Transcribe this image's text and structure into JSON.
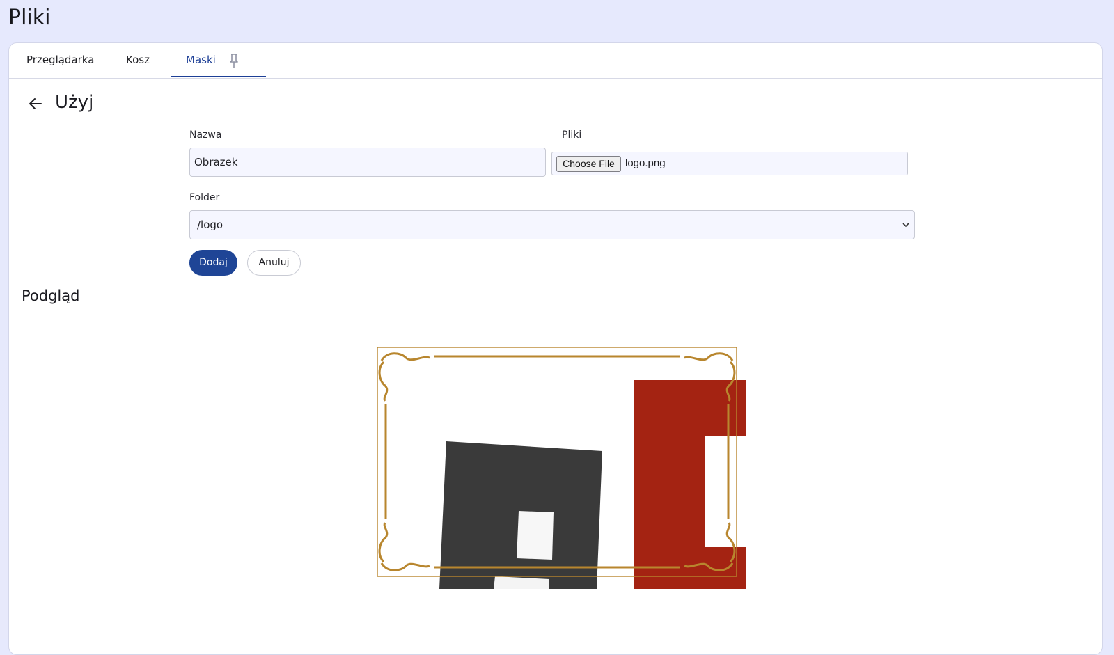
{
  "app": {
    "title": "Pliki"
  },
  "tabs": [
    {
      "label": "Przeglądarka",
      "active": false
    },
    {
      "label": "Kosz",
      "active": false
    },
    {
      "label": "Maski",
      "active": true
    }
  ],
  "page": {
    "title": "Użyj"
  },
  "form": {
    "name": {
      "label": "Nazwa",
      "value": "Obrazek"
    },
    "files": {
      "label": "Pliki",
      "button_label": "Choose File",
      "file_name": "logo.png"
    },
    "folder": {
      "label": "Folder",
      "selected": "/logo"
    },
    "add_label": "Dodaj",
    "cancel_label": "Anuluj"
  },
  "preview": {
    "title": "Podgląd"
  },
  "colors": {
    "accent": "#1f4596",
    "frame_gold": "#b8862e",
    "logo_dark": "#3a3a3a",
    "logo_red": "#a42312",
    "background": "#e6e9fd"
  },
  "icons": {
    "back": "arrow-left-icon",
    "pin": "pin-icon",
    "select_chevron": "chevron-down-icon"
  }
}
